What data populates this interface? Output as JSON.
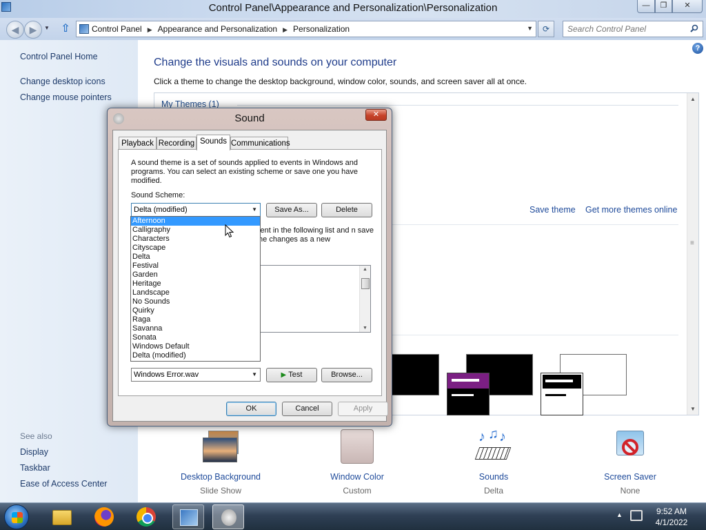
{
  "window": {
    "title": "Control Panel\\Appearance and Personalization\\Personalization",
    "min_glyph": "—",
    "max_glyph": "❐",
    "close_glyph": "✕"
  },
  "address": {
    "crumbs": [
      "Control Panel",
      "Appearance and Personalization",
      "Personalization"
    ],
    "separator": "▶",
    "search_placeholder": "Search Control Panel"
  },
  "nav": {
    "back_glyph": "◀",
    "fwd_glyph": "▶",
    "recent_glyph": "▼",
    "up_glyph": "⇧",
    "refresh_glyph": "⟳"
  },
  "left_pane": {
    "home": "Control Panel Home",
    "links": [
      "Change desktop icons",
      "Change mouse pointers"
    ],
    "see_also_label": "See also",
    "see_also": [
      "Display",
      "Taskbar",
      "Ease of Access Center"
    ]
  },
  "main": {
    "help_glyph": "?",
    "title": "Change the visuals and sounds on your computer",
    "description": "Click a theme to change the desktop background, window color, sounds, and screen saver all at once.",
    "my_themes": "My Themes (1)",
    "save_theme": "Save theme",
    "more_themes": "Get more themes online",
    "features": [
      {
        "label": "Desktop Background",
        "sub": "Slide Show"
      },
      {
        "label": "Window Color",
        "sub": "Custom"
      },
      {
        "label": "Sounds",
        "sub": "Delta"
      },
      {
        "label": "Screen Saver",
        "sub": "None"
      }
    ]
  },
  "dialog": {
    "title": "Sound",
    "close_glyph": "✕",
    "tabs": [
      "Playback",
      "Recording",
      "Sounds",
      "Communications"
    ],
    "active_tab": "Sounds",
    "description": "A sound theme is a set of sounds applied to events in Windows and programs.  You can select an existing scheme or save one you have modified.",
    "scheme_label": "Sound Scheme:",
    "scheme_value": "Delta (modified)",
    "save_as": "Save As...",
    "delete": "Delete",
    "events_text": "vent in the following list and n save the changes as a new",
    "sounds_value": "Windows Error.wav",
    "test": "Test",
    "browse": "Browse...",
    "ok": "OK",
    "cancel": "Cancel",
    "apply": "Apply",
    "scheme_options": [
      "Afternoon",
      "Calligraphy",
      "Characters",
      "Cityscape",
      "Delta",
      "Festival",
      "Garden",
      "Heritage",
      "Landscape",
      "No Sounds",
      "Quirky",
      "Raga",
      "Savanna",
      "Sonata",
      "Windows Default",
      "Delta (modified)"
    ],
    "highlighted_option": "Afternoon"
  },
  "taskbar": {
    "time": "9:52 AM",
    "date": "4/1/2022",
    "tray_glyph": "▲"
  }
}
